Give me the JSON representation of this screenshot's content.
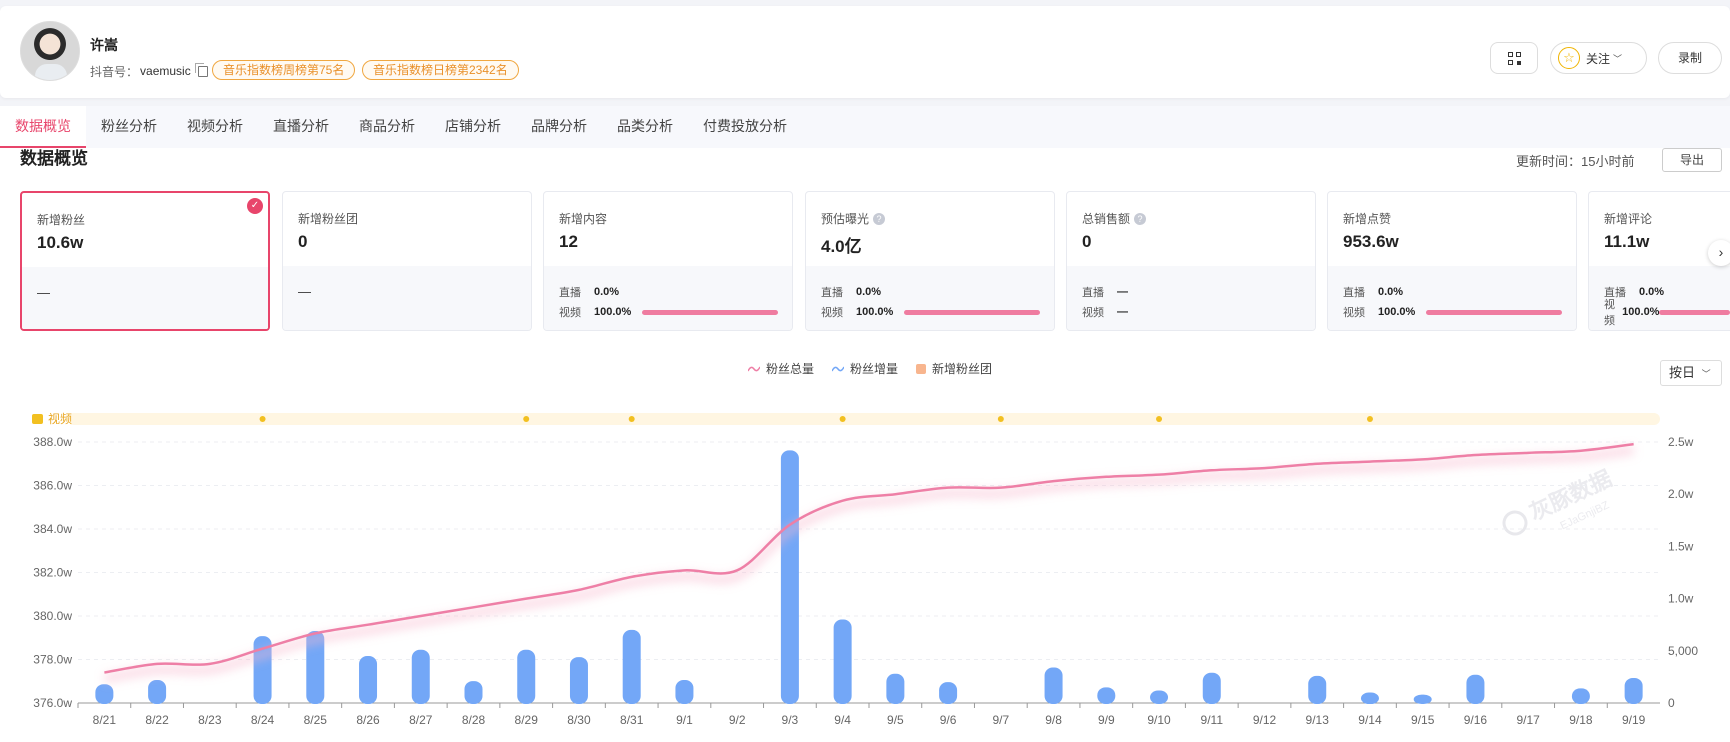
{
  "profile": {
    "name": "许嵩",
    "douyin_label": "抖音号：",
    "douyin_id": "vaemusic",
    "tags": [
      "音乐指数榜周榜第75名",
      "音乐指数榜日榜第2342名"
    ],
    "follow_label": "关注",
    "record_label": "录制"
  },
  "tabs": [
    "数据概览",
    "粉丝分析",
    "视频分析",
    "直播分析",
    "商品分析",
    "店铺分析",
    "品牌分析",
    "品类分析",
    "付费投放分析"
  ],
  "overview": {
    "title": "数据概览",
    "update_time": "更新时间：15小时前",
    "export_label": "导出",
    "cards": [
      {
        "label": "新增粉丝",
        "value": "10.6w",
        "dash": "—"
      },
      {
        "label": "新增粉丝团",
        "value": "0",
        "dash": "—"
      },
      {
        "label": "新增内容",
        "value": "12",
        "live_label": "直播",
        "live_value": "0.0%",
        "video_label": "视频",
        "video_value": "100.0%",
        "video_share": 1.0
      },
      {
        "label": "预估曝光",
        "value": "4.0亿",
        "live_label": "直播",
        "live_value": "0.0%",
        "video_label": "视频",
        "video_value": "100.0%",
        "video_share": 1.0
      },
      {
        "label": "总销售额",
        "value": "0",
        "live_label": "直播",
        "live_value": "—",
        "video_label": "视频",
        "video_value": "—"
      },
      {
        "label": "新增点赞",
        "value": "953.6w",
        "live_label": "直播",
        "live_value": "0.0%",
        "video_label": "视频",
        "video_value": "100.0%",
        "video_share": 1.0
      },
      {
        "label": "新增评论",
        "value": "11.1w",
        "live_label": "直播",
        "live_value": "0.0%",
        "video_label": "视频",
        "video_value": "100.0%",
        "video_share": 1.0
      }
    ]
  },
  "legend": {
    "total": "粉丝总量",
    "increase": "粉丝增量",
    "fan_club": "新增粉丝团"
  },
  "granularity": "按日",
  "video_track_label": "视频",
  "watermark": {
    "text": "灰豚数据",
    "subtext": "EJaGnjiBZ"
  },
  "colors": {
    "accent": "#e8456b",
    "bar": "#73a7f7",
    "line": "#ee7fa6",
    "video_dot": "#f2c021"
  },
  "chart_data": {
    "type": "bar+line",
    "categories": [
      "8/21",
      "8/22",
      "8/23",
      "8/24",
      "8/25",
      "8/26",
      "8/27",
      "8/28",
      "8/29",
      "8/30",
      "8/31",
      "9/1",
      "9/2",
      "9/3",
      "9/4",
      "9/5",
      "9/6",
      "9/7",
      "9/8",
      "9/9",
      "9/10",
      "9/11",
      "9/12",
      "9/13",
      "9/14",
      "9/15",
      "9/16",
      "9/17",
      "9/18",
      "9/19"
    ],
    "left_axis": {
      "ticks": [
        "376.0w",
        "378.0w",
        "380.0w",
        "382.0w",
        "384.0w",
        "386.0w",
        "388.0w"
      ],
      "min": 376.0,
      "max": 388.0
    },
    "right_axis": {
      "ticks": [
        "0",
        "5,000",
        "1.0w",
        "1.5w",
        "2.0w",
        "2.5w"
      ],
      "min": 0,
      "max": 25000
    },
    "series": [
      {
        "name": "粉丝增量",
        "type": "bar",
        "axis": "right",
        "values": [
          1800,
          2200,
          0,
          6400,
          6900,
          4500,
          5100,
          2100,
          5100,
          4400,
          7000,
          2200,
          0,
          24200,
          8000,
          2800,
          2000,
          0,
          3400,
          1500,
          1200,
          2900,
          0,
          2600,
          1000,
          800,
          2700,
          0,
          1400,
          2400
        ]
      },
      {
        "name": "粉丝总量",
        "type": "line",
        "axis": "left",
        "values": [
          377.4,
          377.8,
          377.8,
          378.5,
          379.2,
          379.6,
          380.0,
          380.4,
          380.8,
          381.2,
          381.8,
          382.1,
          382.1,
          384.2,
          385.3,
          385.6,
          385.9,
          385.9,
          386.2,
          386.4,
          386.5,
          386.7,
          386.8,
          387.0,
          387.1,
          387.2,
          387.4,
          387.5,
          387.6,
          387.9
        ]
      }
    ],
    "video_posts": [
      "8/24",
      "8/29",
      "8/31",
      "9/4",
      "9/7",
      "9/10",
      "9/14"
    ]
  }
}
